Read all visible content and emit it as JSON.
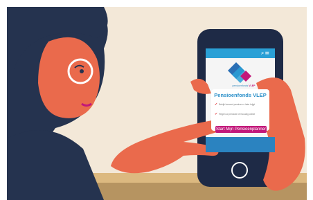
{
  "phone": {
    "brand_caption_prefix": "pensioenfonds",
    "brand_caption_accent": "VLEP",
    "card_title": "Pensioenfonds VLEP",
    "checklist": [
      "Bekijk hoeveel pensioen u later krijgt",
      "Regel uw pensioen eenvoudig online"
    ],
    "cta_label": "Start Mijn Pensioenplanner",
    "menu_icon": "hamburger-menu-icon",
    "search_icon": "search-icon"
  },
  "colors": {
    "brand_blue": "#2aa0d6",
    "brand_magenta": "#c2187a",
    "skin": "#ea6a4c",
    "hair": "#25334f",
    "background": "#f3e8d8"
  }
}
